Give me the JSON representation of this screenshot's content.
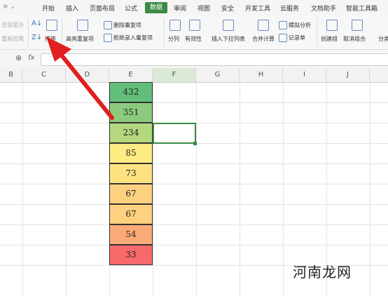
{
  "menubar": {
    "items": [
      "开始",
      "插入",
      "页面布局",
      "公式",
      "审阅",
      "视图",
      "安全",
      "开发工具",
      "云服务",
      "文档助手",
      "智能工具箱"
    ],
    "active": "数据"
  },
  "ribbon": {
    "show_all": "全部显示",
    "reapply": "重新应用",
    "sort": "排序",
    "highlight_dup": "高亮重复项",
    "delete_dup": "删除重复项",
    "reject_dup": "拒绝录入重复项",
    "split": "分列",
    "validity": "有效性",
    "insert_dropdown": "插入下拉列表",
    "consolidate": "合并计算",
    "simulate": "模拟分析",
    "record": "记录单",
    "create_group": "创建组",
    "ungroup": "取消组合",
    "classify": "分类"
  },
  "formula": {
    "fx": "fx"
  },
  "columns": [
    "B",
    "C",
    "D",
    "E",
    "F",
    "G",
    "H",
    "I",
    "J"
  ],
  "cells": [
    "432",
    "351",
    "234",
    "85",
    "73",
    "67",
    "67",
    "54",
    "33"
  ],
  "cell_colors": [
    "#63be7b",
    "#8ccb7e",
    "#b4d87e",
    "#ffeb84",
    "#fee282",
    "#fdd17f",
    "#fdd17f",
    "#fcaa78",
    "#f8696b"
  ],
  "watermark": "河南龙网",
  "accent": "#3a8c44"
}
